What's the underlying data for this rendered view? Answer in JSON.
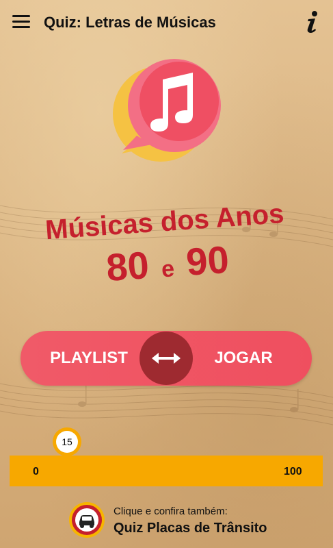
{
  "app_bar": {
    "title": "Quiz: Letras de Músicas"
  },
  "icons": {
    "menu": "hamburger-menu-icon",
    "info": "info-icon",
    "logo": "music-note-chat-bubble-icon",
    "swap": "double-arrow-icon",
    "car": "car-icon"
  },
  "headline": {
    "line1": "Músicas dos Anos",
    "year_a": "80",
    "conjunction": "e",
    "year_b": "90"
  },
  "toggle": {
    "left_label": "PLAYLIST",
    "right_label": "JOGAR"
  },
  "slider": {
    "value": "15",
    "min_label": "0",
    "max_label": "100"
  },
  "promo": {
    "subtitle": "Clique e confira também:",
    "title": "Quiz Placas de Trânsito"
  },
  "colors": {
    "accent_red": "#ef4f5f",
    "knob": "#9e2a30",
    "headline_red": "#c5202d",
    "slider_orange": "#f7a800",
    "logo_yellow": "#f5c243",
    "logo_pink": "#f05a73"
  }
}
